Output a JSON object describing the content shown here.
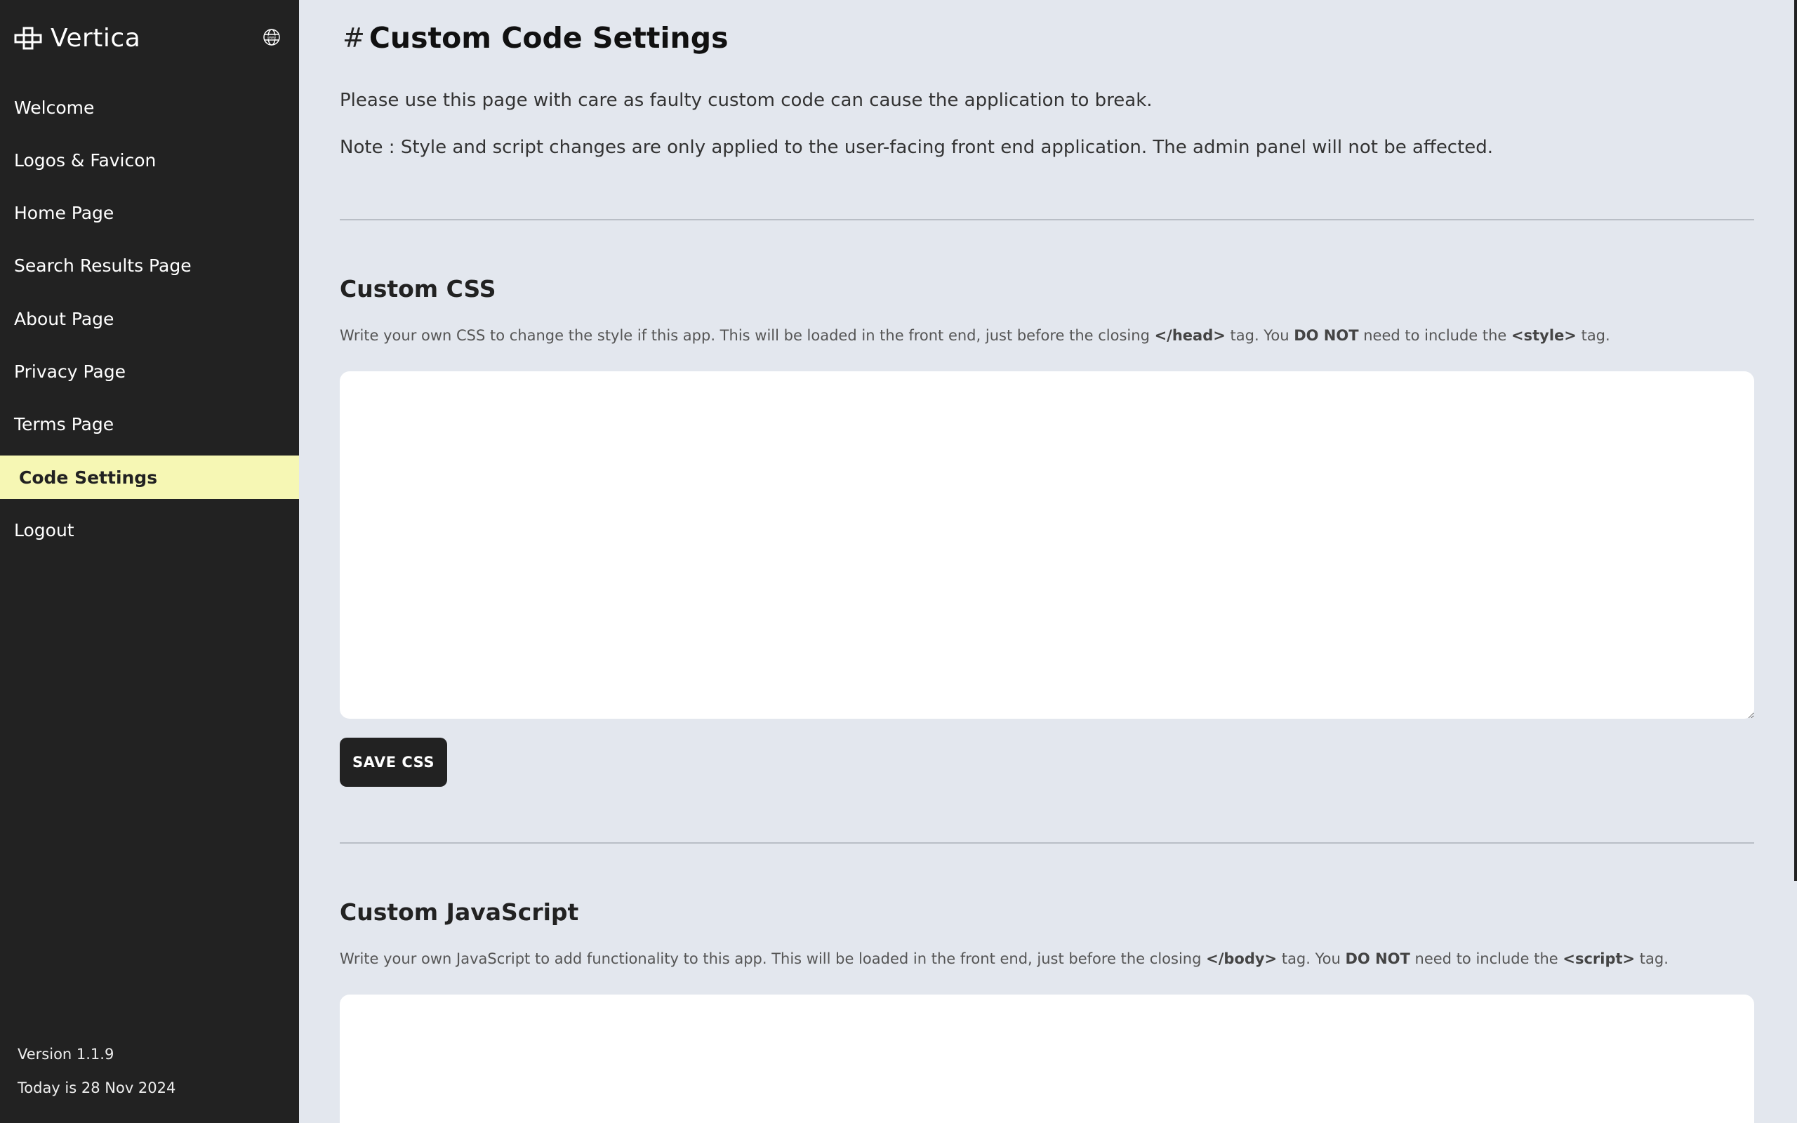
{
  "app": {
    "name": "Vertica",
    "logo_icon": "grid-cross-icon",
    "language_icon": "globe-www-icon"
  },
  "sidebar": {
    "items": [
      {
        "label": "Welcome",
        "active": false
      },
      {
        "label": "Logos & Favicon",
        "active": false
      },
      {
        "label": "Home Page",
        "active": false
      },
      {
        "label": "Search Results Page",
        "active": false
      },
      {
        "label": "About Page",
        "active": false
      },
      {
        "label": "Privacy Page",
        "active": false
      },
      {
        "label": "Terms Page",
        "active": false
      },
      {
        "label": "Code Settings",
        "active": true
      },
      {
        "label": "Logout",
        "active": false
      }
    ],
    "version": "Version 1.1.9",
    "today": "Today is 28 Nov 2024"
  },
  "page": {
    "hash": "#",
    "title": "Custom Code Settings",
    "intro": "Please use this page with care as faulty custom code can cause the application to break.",
    "note": "Note : Style and script changes are only applied to the user-facing front end application. The admin panel will not be affected."
  },
  "css_section": {
    "title": "Custom CSS",
    "desc_1": "Write your own CSS to change the style if this app. This will be loaded in the front end, just before the closing ",
    "tag_1": "</head>",
    "desc_2": " tag. You ",
    "emphasis": "DO NOT",
    "desc_3": " need to include the ",
    "tag_2": "<style>",
    "desc_4": " tag.",
    "value": "",
    "button": "SAVE CSS"
  },
  "js_section": {
    "title": "Custom JavaScript",
    "desc_1": "Write your own JavaScript to add functionality to this app. This will be loaded in the front end, just before the closing ",
    "tag_1": "</body>",
    "desc_2": " tag. You ",
    "emphasis": "DO NOT",
    "desc_3": " need to include the ",
    "tag_2": "<script>",
    "desc_4": " tag.",
    "value": ""
  },
  "colors": {
    "sidebar_bg": "#222222",
    "active_item_bg": "#f6f7b4",
    "page_bg": "#e3e7ee",
    "button_bg": "#222222"
  }
}
